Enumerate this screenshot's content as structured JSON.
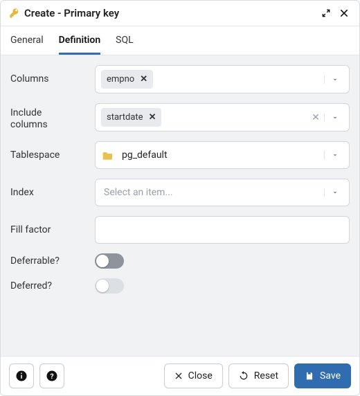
{
  "header": {
    "title": "Create - Primary key"
  },
  "tabs": {
    "items": [
      "General",
      "Definition",
      "SQL"
    ],
    "active_index": 1
  },
  "form": {
    "columns": {
      "label": "Columns",
      "chips": [
        "empno"
      ]
    },
    "include_columns": {
      "label": "Include columns",
      "chips": [
        "startdate"
      ]
    },
    "tablespace": {
      "label": "Tablespace",
      "value": "pg_default"
    },
    "index": {
      "label": "Index",
      "placeholder": "Select an item..."
    },
    "fill_factor": {
      "label": "Fill factor",
      "value": ""
    },
    "deferrable": {
      "label": "Deferrable?",
      "value": false
    },
    "deferred": {
      "label": "Deferred?",
      "value": false
    }
  },
  "footer": {
    "close": "Close",
    "reset": "Reset",
    "save": "Save"
  }
}
